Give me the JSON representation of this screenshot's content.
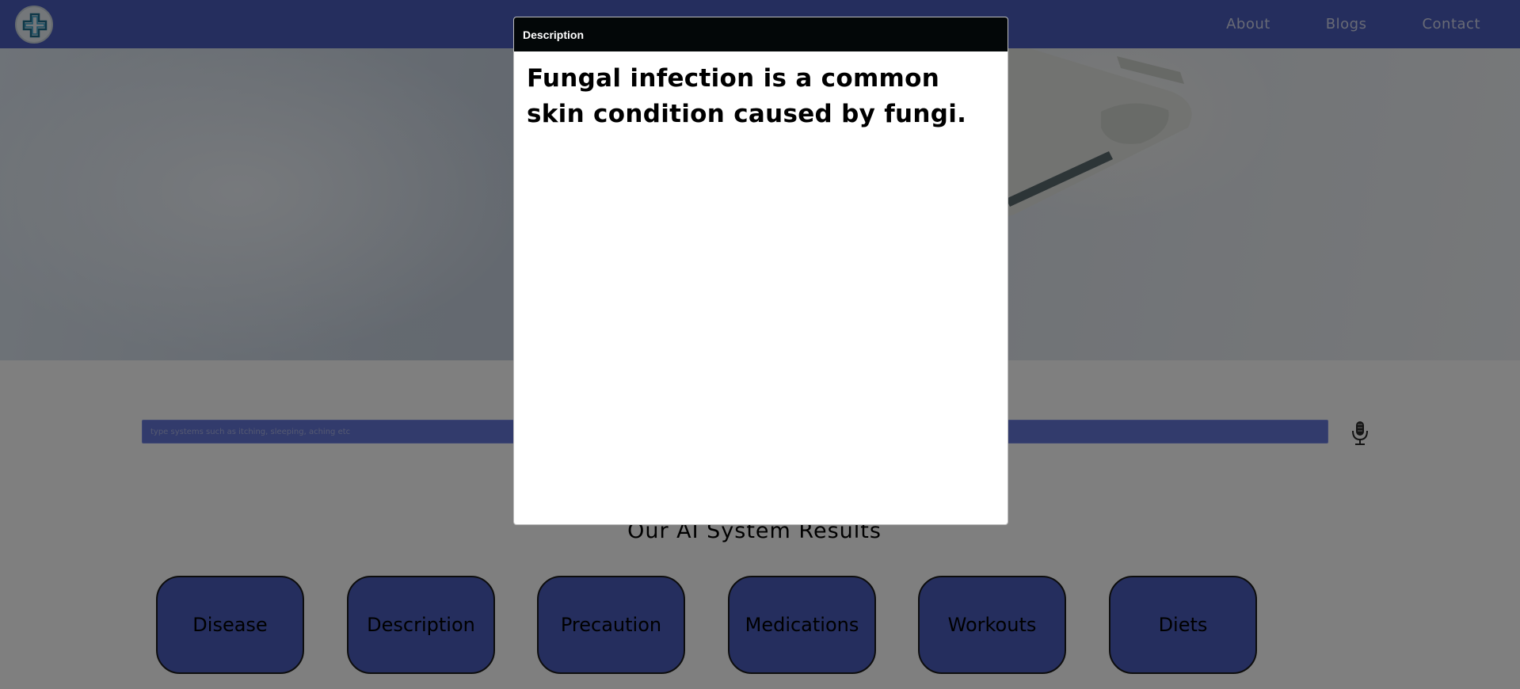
{
  "navbar": {
    "links": [
      {
        "label": "About"
      },
      {
        "label": "Blogs"
      },
      {
        "label": "Contact"
      }
    ]
  },
  "search": {
    "placeholder": "type systems such as itching, sleeping, aching etc",
    "value": ""
  },
  "results": {
    "title": "Our AI System Results",
    "buttons": [
      {
        "label": "Disease"
      },
      {
        "label": "Description"
      },
      {
        "label": "Precaution"
      },
      {
        "label": "Medications"
      },
      {
        "label": "Workouts"
      },
      {
        "label": "Diets"
      }
    ]
  },
  "modal": {
    "title": "Description",
    "body": "Fungal infection is a common skin condition caused by fungi."
  },
  "colors": {
    "brand": "#4a5dbd",
    "search_bar": "#6577d9",
    "modal_header": "#030708",
    "overlay": "rgba(0,0,0,0.5)"
  },
  "icons": {
    "logo": "medical-cross-logo-icon",
    "microphone": "microphone-icon"
  }
}
